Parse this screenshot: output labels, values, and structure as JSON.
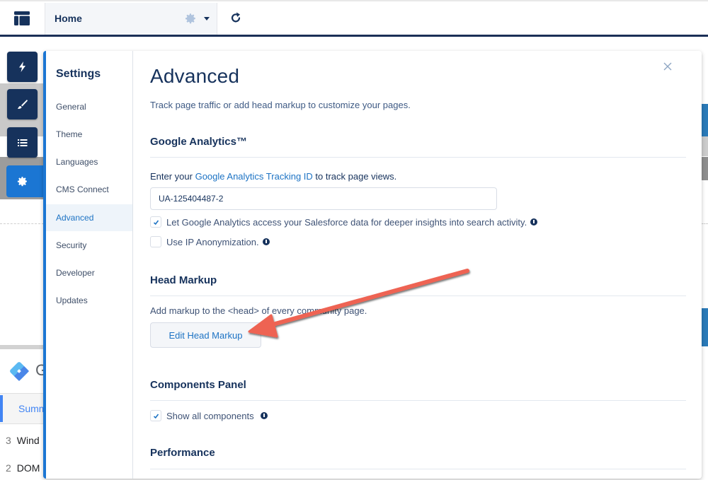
{
  "topbar": {
    "page_name": "Home",
    "icons": {
      "app": "layout-icon",
      "gear": "gear-icon",
      "caret": "caret-down-icon",
      "refresh": "refresh-icon"
    }
  },
  "rail": {
    "items": [
      {
        "icon": "lightning-icon",
        "active": false
      },
      {
        "icon": "paintbrush-icon",
        "active": false
      },
      {
        "icon": "list-icon",
        "active": false
      },
      {
        "icon": "gear-icon",
        "active": true
      }
    ]
  },
  "background": {
    "gtm_letter": "G",
    "tab_label": "Summ",
    "rows": [
      {
        "num": "3",
        "label": "Wind"
      },
      {
        "num": "2",
        "label": "DOM"
      }
    ]
  },
  "settings": {
    "title": "Settings",
    "nav": [
      {
        "label": "General",
        "active": false
      },
      {
        "label": "Theme",
        "active": false
      },
      {
        "label": "Languages",
        "active": false
      },
      {
        "label": "CMS Connect",
        "active": false
      },
      {
        "label": "Advanced",
        "active": true
      },
      {
        "label": "Security",
        "active": false
      },
      {
        "label": "Developer",
        "active": false
      },
      {
        "label": "Updates",
        "active": false
      }
    ]
  },
  "advanced": {
    "title": "Advanced",
    "description": "Track page traffic or add head markup to customize your pages.",
    "google_analytics": {
      "heading": "Google Analytics™",
      "intro_prefix": "Enter your ",
      "intro_link": "Google Analytics Tracking ID",
      "intro_suffix": " to track page views.",
      "tracking_id": "UA-125404487-2",
      "options": [
        {
          "label": "Let Google Analytics access your Salesforce data for deeper insights into search activity.",
          "checked": true
        },
        {
          "label": "Use IP Anonymization.",
          "checked": false
        }
      ]
    },
    "head_markup": {
      "heading": "Head Markup",
      "description": "Add markup to the <head> of every community page.",
      "button": "Edit Head Markup"
    },
    "components_panel": {
      "heading": "Components Panel",
      "option": {
        "label": "Show all components",
        "checked": true
      }
    },
    "performance": {
      "heading": "Performance"
    }
  },
  "annotation": {
    "type": "arrow",
    "color": "#e8604c",
    "points_to": "Edit Head Markup"
  }
}
